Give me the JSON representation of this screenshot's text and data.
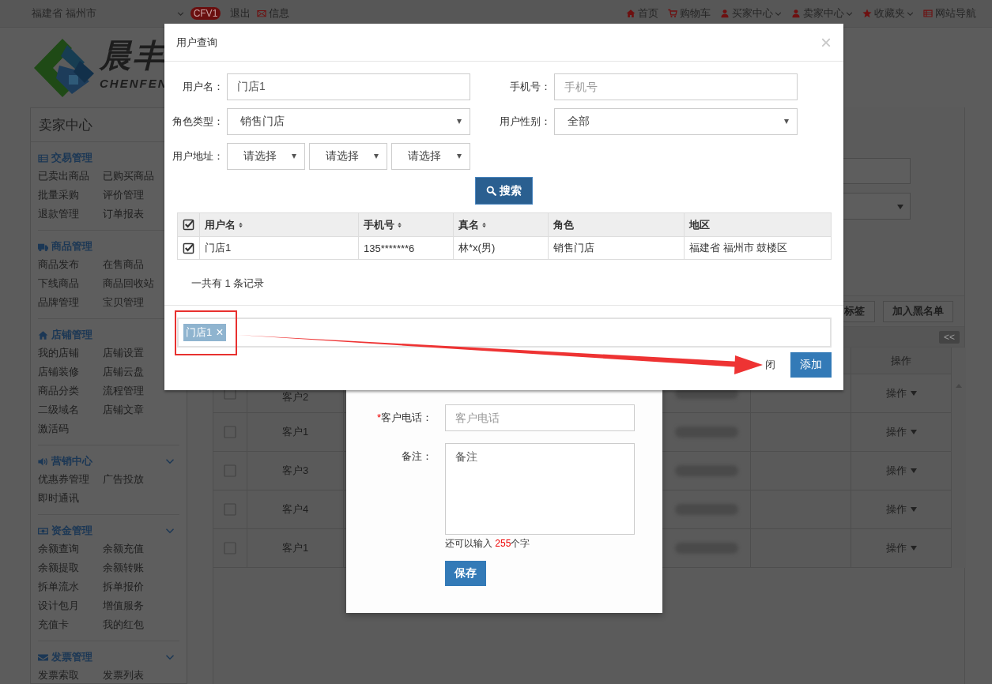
{
  "top_bar": {
    "location": "福建省 福州市",
    "version_badge": "CFV1",
    "logout": "退出",
    "messages": "信息",
    "links": [
      {
        "label": "首页",
        "kind": "home",
        "dropdown": false
      },
      {
        "label": "购物车",
        "kind": "cart",
        "dropdown": false
      },
      {
        "label": "买家中心",
        "kind": "user",
        "dropdown": true
      },
      {
        "label": "卖家中心",
        "kind": "user",
        "dropdown": true
      },
      {
        "label": "收藏夹",
        "kind": "star",
        "dropdown": true
      },
      {
        "label": "网站导航",
        "kind": "list",
        "dropdown": false
      }
    ]
  },
  "logo": {
    "title": "晨丰",
    "subtitle": "CHENFEN"
  },
  "sidebar": {
    "title": "卖家中心",
    "sections": [
      {
        "title": "交易管理",
        "kind": "list",
        "collapsible": false,
        "items": [
          "已卖出商品",
          "已购买商品",
          "批量采购",
          "评价管理",
          "退款管理",
          "订单报表"
        ]
      },
      {
        "title": "商品管理",
        "kind": "truck",
        "collapsible": false,
        "items": [
          "商品发布",
          "在售商品",
          "下线商品",
          "商品回收站",
          "品牌管理",
          "宝贝管理"
        ]
      },
      {
        "title": "店铺管理",
        "kind": "home",
        "collapsible": false,
        "items": [
          "我的店铺",
          "店铺设置",
          "店铺装修",
          "店铺云盘",
          "商品分类",
          "流程管理",
          "二级域名",
          "店铺文章",
          "激活码"
        ]
      },
      {
        "title": "营销中心",
        "kind": "speaker",
        "collapsible": true,
        "items": [
          "优惠券管理",
          "广告投放",
          "即时通讯"
        ]
      },
      {
        "title": "资金管理",
        "kind": "money",
        "collapsible": true,
        "items": [
          "余额查询",
          "余额充值",
          "余额提取",
          "余额转账",
          "拆单流水",
          "拆单报价",
          "设计包月",
          "增值服务",
          "充值卡",
          "我的红包"
        ]
      },
      {
        "title": "发票管理",
        "kind": "envelope",
        "collapsible": true,
        "items": [
          "发票索取",
          "发票列表"
        ]
      }
    ]
  },
  "customer_table": {
    "toolbar_buttons": [
      "标签",
      "加入黑名单"
    ],
    "collapse_button": "<<",
    "action_header": "操作",
    "rows": [
      {
        "name": "客户2",
        "checked": false,
        "action": "操作"
      },
      {
        "name": "客户1",
        "checked": false,
        "action": "操作"
      },
      {
        "name": "客户3",
        "checked": false,
        "action": "操作"
      },
      {
        "name": "客户4",
        "checked": false,
        "action": "操作"
      },
      {
        "name": "客户1",
        "checked": false,
        "action": "操作"
      }
    ]
  },
  "customer_form": {
    "fields": [
      {
        "kind": "input",
        "label": "客户电话：",
        "required": true,
        "required_mark": "*",
        "placeholder": "客户电话"
      },
      {
        "kind": "textarea",
        "label": "备注：",
        "placeholder": "备注"
      }
    ],
    "char_counter": {
      "prefix": "还可以输入 ",
      "count": "255",
      "suffix": "个字"
    },
    "save_button": "保存"
  },
  "user_query_dialog": {
    "title": "用户查询",
    "close": "×",
    "fields": [
      {
        "kind": "input",
        "label": "用户名：",
        "value": "门店1"
      },
      {
        "kind": "input",
        "label": "手机号：",
        "placeholder": "手机号"
      },
      {
        "kind": "select",
        "label": "角色类型：",
        "value": "销售门店"
      },
      {
        "kind": "select",
        "label": "用户性别：",
        "value": "全部"
      },
      {
        "kind": "select_group",
        "label": "用户地址：",
        "values": [
          "请选择",
          "请选择",
          "请选择"
        ]
      }
    ],
    "search_button": "搜索",
    "table": {
      "all_checked": true,
      "columns": [
        {
          "label": "用户名",
          "sortable": true
        },
        {
          "label": "手机号",
          "sortable": true
        },
        {
          "label": "真名",
          "sortable": true
        },
        {
          "label": "角色",
          "sortable": false
        },
        {
          "label": "地区",
          "sortable": false
        }
      ],
      "rows": [
        {
          "checked": true,
          "cells": [
            "门店1",
            "135*******6",
            "林*x(男)",
            "销售门店",
            "福建省 福州市 鼓楼区"
          ]
        }
      ]
    },
    "record_count": "一共有 1 条记录",
    "selected_tags": [
      {
        "label": "门店1",
        "remove": "×"
      }
    ],
    "close_button": "闭",
    "add_button": "添加"
  }
}
